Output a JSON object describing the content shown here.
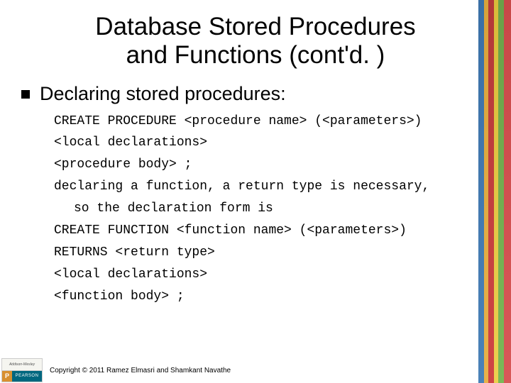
{
  "title_line1": "Database Stored Procedures",
  "title_line2": "and Functions (cont'd. )",
  "bullet": "Declaring stored procedures:",
  "lines": [
    "CREATE PROCEDURE <procedure name> (<parameters>)",
    "<local declarations>",
    "<procedure body> ;",
    "declaring a function, a return type is necessary,",
    "so the declaration form is",
    "CREATE FUNCTION <function name> (<parameters>)",
    "RETURNS <return type>",
    "<local declarations>",
    "<function body> ;"
  ],
  "logo": {
    "top": "Addison-Wesley",
    "p": "P",
    "name": "PEARSON"
  },
  "copyright": "Copyright © 2011 Ramez Elmasri and Shamkant Navathe"
}
